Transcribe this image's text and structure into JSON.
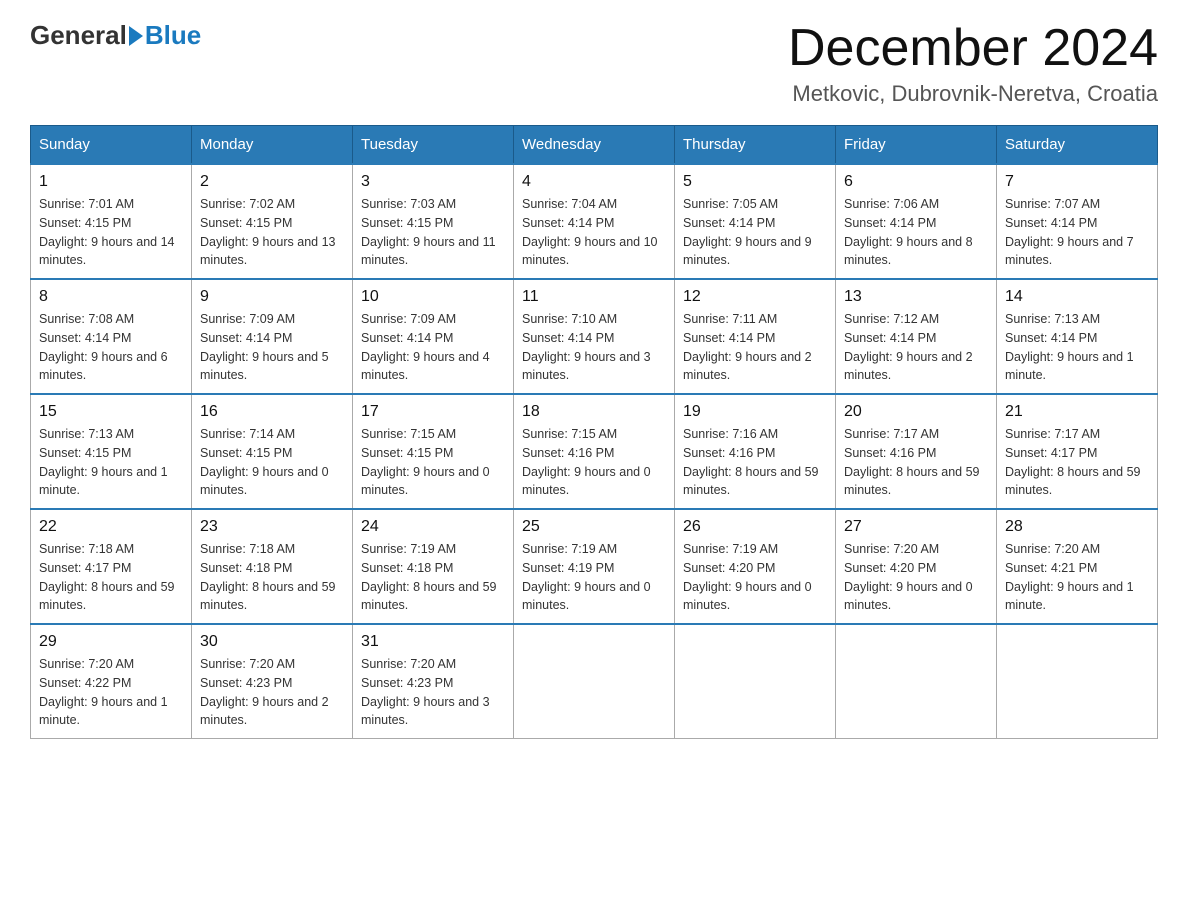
{
  "header": {
    "logo_general": "General",
    "logo_blue": "Blue",
    "month_title": "December 2024",
    "location": "Metkovic, Dubrovnik-Neretva, Croatia"
  },
  "weekdays": [
    "Sunday",
    "Monday",
    "Tuesday",
    "Wednesday",
    "Thursday",
    "Friday",
    "Saturday"
  ],
  "weeks": [
    [
      {
        "day": "1",
        "sunrise": "Sunrise: 7:01 AM",
        "sunset": "Sunset: 4:15 PM",
        "daylight": "Daylight: 9 hours and 14 minutes."
      },
      {
        "day": "2",
        "sunrise": "Sunrise: 7:02 AM",
        "sunset": "Sunset: 4:15 PM",
        "daylight": "Daylight: 9 hours and 13 minutes."
      },
      {
        "day": "3",
        "sunrise": "Sunrise: 7:03 AM",
        "sunset": "Sunset: 4:15 PM",
        "daylight": "Daylight: 9 hours and 11 minutes."
      },
      {
        "day": "4",
        "sunrise": "Sunrise: 7:04 AM",
        "sunset": "Sunset: 4:14 PM",
        "daylight": "Daylight: 9 hours and 10 minutes."
      },
      {
        "day": "5",
        "sunrise": "Sunrise: 7:05 AM",
        "sunset": "Sunset: 4:14 PM",
        "daylight": "Daylight: 9 hours and 9 minutes."
      },
      {
        "day": "6",
        "sunrise": "Sunrise: 7:06 AM",
        "sunset": "Sunset: 4:14 PM",
        "daylight": "Daylight: 9 hours and 8 minutes."
      },
      {
        "day": "7",
        "sunrise": "Sunrise: 7:07 AM",
        "sunset": "Sunset: 4:14 PM",
        "daylight": "Daylight: 9 hours and 7 minutes."
      }
    ],
    [
      {
        "day": "8",
        "sunrise": "Sunrise: 7:08 AM",
        "sunset": "Sunset: 4:14 PM",
        "daylight": "Daylight: 9 hours and 6 minutes."
      },
      {
        "day": "9",
        "sunrise": "Sunrise: 7:09 AM",
        "sunset": "Sunset: 4:14 PM",
        "daylight": "Daylight: 9 hours and 5 minutes."
      },
      {
        "day": "10",
        "sunrise": "Sunrise: 7:09 AM",
        "sunset": "Sunset: 4:14 PM",
        "daylight": "Daylight: 9 hours and 4 minutes."
      },
      {
        "day": "11",
        "sunrise": "Sunrise: 7:10 AM",
        "sunset": "Sunset: 4:14 PM",
        "daylight": "Daylight: 9 hours and 3 minutes."
      },
      {
        "day": "12",
        "sunrise": "Sunrise: 7:11 AM",
        "sunset": "Sunset: 4:14 PM",
        "daylight": "Daylight: 9 hours and 2 minutes."
      },
      {
        "day": "13",
        "sunrise": "Sunrise: 7:12 AM",
        "sunset": "Sunset: 4:14 PM",
        "daylight": "Daylight: 9 hours and 2 minutes."
      },
      {
        "day": "14",
        "sunrise": "Sunrise: 7:13 AM",
        "sunset": "Sunset: 4:14 PM",
        "daylight": "Daylight: 9 hours and 1 minute."
      }
    ],
    [
      {
        "day": "15",
        "sunrise": "Sunrise: 7:13 AM",
        "sunset": "Sunset: 4:15 PM",
        "daylight": "Daylight: 9 hours and 1 minute."
      },
      {
        "day": "16",
        "sunrise": "Sunrise: 7:14 AM",
        "sunset": "Sunset: 4:15 PM",
        "daylight": "Daylight: 9 hours and 0 minutes."
      },
      {
        "day": "17",
        "sunrise": "Sunrise: 7:15 AM",
        "sunset": "Sunset: 4:15 PM",
        "daylight": "Daylight: 9 hours and 0 minutes."
      },
      {
        "day": "18",
        "sunrise": "Sunrise: 7:15 AM",
        "sunset": "Sunset: 4:16 PM",
        "daylight": "Daylight: 9 hours and 0 minutes."
      },
      {
        "day": "19",
        "sunrise": "Sunrise: 7:16 AM",
        "sunset": "Sunset: 4:16 PM",
        "daylight": "Daylight: 8 hours and 59 minutes."
      },
      {
        "day": "20",
        "sunrise": "Sunrise: 7:17 AM",
        "sunset": "Sunset: 4:16 PM",
        "daylight": "Daylight: 8 hours and 59 minutes."
      },
      {
        "day": "21",
        "sunrise": "Sunrise: 7:17 AM",
        "sunset": "Sunset: 4:17 PM",
        "daylight": "Daylight: 8 hours and 59 minutes."
      }
    ],
    [
      {
        "day": "22",
        "sunrise": "Sunrise: 7:18 AM",
        "sunset": "Sunset: 4:17 PM",
        "daylight": "Daylight: 8 hours and 59 minutes."
      },
      {
        "day": "23",
        "sunrise": "Sunrise: 7:18 AM",
        "sunset": "Sunset: 4:18 PM",
        "daylight": "Daylight: 8 hours and 59 minutes."
      },
      {
        "day": "24",
        "sunrise": "Sunrise: 7:19 AM",
        "sunset": "Sunset: 4:18 PM",
        "daylight": "Daylight: 8 hours and 59 minutes."
      },
      {
        "day": "25",
        "sunrise": "Sunrise: 7:19 AM",
        "sunset": "Sunset: 4:19 PM",
        "daylight": "Daylight: 9 hours and 0 minutes."
      },
      {
        "day": "26",
        "sunrise": "Sunrise: 7:19 AM",
        "sunset": "Sunset: 4:20 PM",
        "daylight": "Daylight: 9 hours and 0 minutes."
      },
      {
        "day": "27",
        "sunrise": "Sunrise: 7:20 AM",
        "sunset": "Sunset: 4:20 PM",
        "daylight": "Daylight: 9 hours and 0 minutes."
      },
      {
        "day": "28",
        "sunrise": "Sunrise: 7:20 AM",
        "sunset": "Sunset: 4:21 PM",
        "daylight": "Daylight: 9 hours and 1 minute."
      }
    ],
    [
      {
        "day": "29",
        "sunrise": "Sunrise: 7:20 AM",
        "sunset": "Sunset: 4:22 PM",
        "daylight": "Daylight: 9 hours and 1 minute."
      },
      {
        "day": "30",
        "sunrise": "Sunrise: 7:20 AM",
        "sunset": "Sunset: 4:23 PM",
        "daylight": "Daylight: 9 hours and 2 minutes."
      },
      {
        "day": "31",
        "sunrise": "Sunrise: 7:20 AM",
        "sunset": "Sunset: 4:23 PM",
        "daylight": "Daylight: 9 hours and 3 minutes."
      },
      null,
      null,
      null,
      null
    ]
  ]
}
